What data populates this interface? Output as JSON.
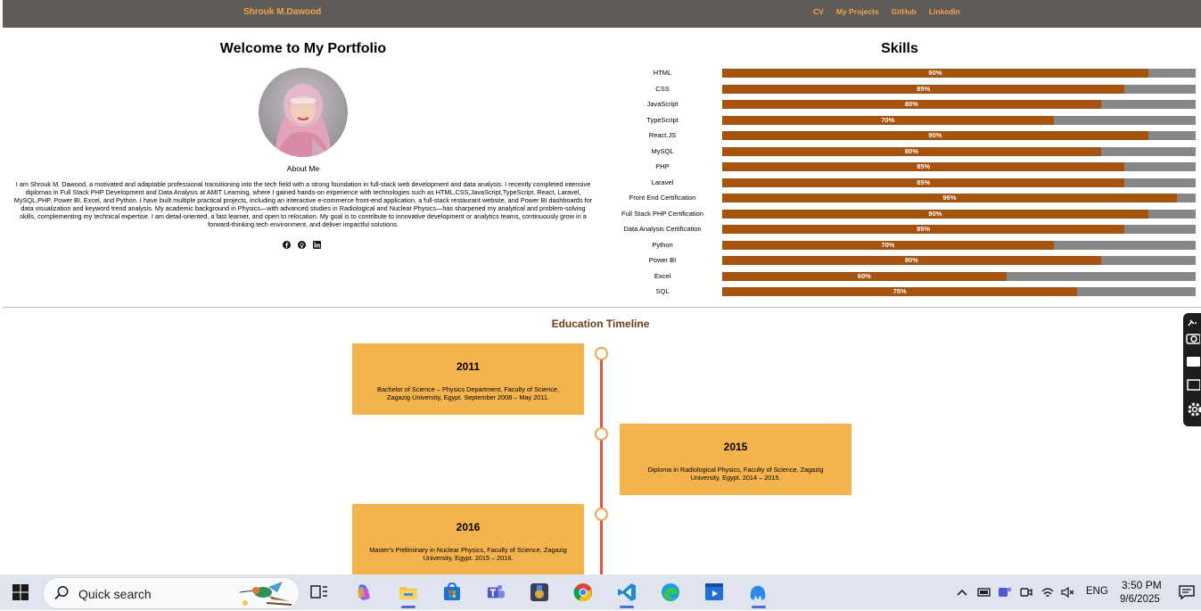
{
  "nav": {
    "brand": "Shrouk M.Dawood",
    "links": [
      "CV",
      "My Projects",
      "GitHub",
      "LinkedIn"
    ]
  },
  "profile": {
    "welcome": "Welcome to My Portfolio",
    "about_title": "About Me",
    "about_text": "I am Shrouk M. Dawood, a motivated and adaptable professional transitioning into the tech field with a strong foundation in full-stack web development and data analysis. I recently completed intensive diplomas in Full Stack PHP Development and Data Analysis at AMIT Learning, where I gained hands-on experience with technologies such as HTML,CSS,JavaScript,TypeScript, React, Laravel, MySQL,PHP, Power BI, Excel, and Python. I have built multiple practical projects, including an interactive e-commerce front-end application, a full-stack restaurant website, and Power BI dashboards for data visualization and keyword trend analysis. My academic background in Physics—with advanced studies in Radiological and Nuclear Physics—has sharpened my analytical and problem-solving skills, complementing my technical expertise. I am detail-oriented, a fast learner, and open to relocation. My goal is to contribute to innovative development or analytics teams, continuously grow in a forward-thinking tech environment, and deliver impactful solutions.",
    "social_icons": [
      "facebook-icon",
      "github-icon",
      "linkedin-icon"
    ]
  },
  "skills": {
    "title": "Skills",
    "items": [
      {
        "name": "HTML",
        "pct": 90,
        "label": "90%"
      },
      {
        "name": "CSS",
        "pct": 85,
        "label": "85%"
      },
      {
        "name": "JavaScript",
        "pct": 80,
        "label": "80%"
      },
      {
        "name": "TypeScript",
        "pct": 70,
        "label": "70%"
      },
      {
        "name": "React.JS",
        "pct": 90,
        "label": "90%"
      },
      {
        "name": "MySQL",
        "pct": 80,
        "label": "80%"
      },
      {
        "name": "PHP",
        "pct": 85,
        "label": "85%"
      },
      {
        "name": "Laravel",
        "pct": 85,
        "label": "85%"
      },
      {
        "name": "Front End Certification",
        "pct": 96,
        "label": "96%"
      },
      {
        "name": "Full Stack PHP Certification",
        "pct": 90,
        "label": "90%"
      },
      {
        "name": "Data Analysis Certification",
        "pct": 85,
        "label": "85%"
      },
      {
        "name": "Python",
        "pct": 70,
        "label": "70%"
      },
      {
        "name": "Power BI",
        "pct": 80,
        "label": "80%"
      },
      {
        "name": "Excel",
        "pct": 60,
        "label": "60%"
      },
      {
        "name": "SQL",
        "pct": 75,
        "label": "75%"
      }
    ]
  },
  "timeline": {
    "title": "Education Timeline",
    "entries": [
      {
        "year": "2011",
        "desc": "Bachelor of Science – Physics Department, Faculty of Science, Zagazig University, Egypt. September 2008 – May 2011.",
        "side": "left"
      },
      {
        "year": "2015",
        "desc": "Diploma in Radiological Physics, Faculty of Science, Zagazig University, Egypt. 2014 – 2015.",
        "side": "right"
      },
      {
        "year": "2016",
        "desc": "Master's Preliminary in Nuclear Physics, Faculty of Science, Zagazig University, Egypt. 2015 – 2016.",
        "side": "left"
      }
    ]
  },
  "colors": {
    "accent": "#f0a24a",
    "bar_fill": "#a5530f",
    "bar_track": "#878787",
    "card": "#f5b34d",
    "timeline_line": "#e8513c"
  },
  "taskbar": {
    "search_placeholder": "Quick search",
    "language": "ENG",
    "time": "3:50 PM",
    "date": "9/6/2025"
  }
}
